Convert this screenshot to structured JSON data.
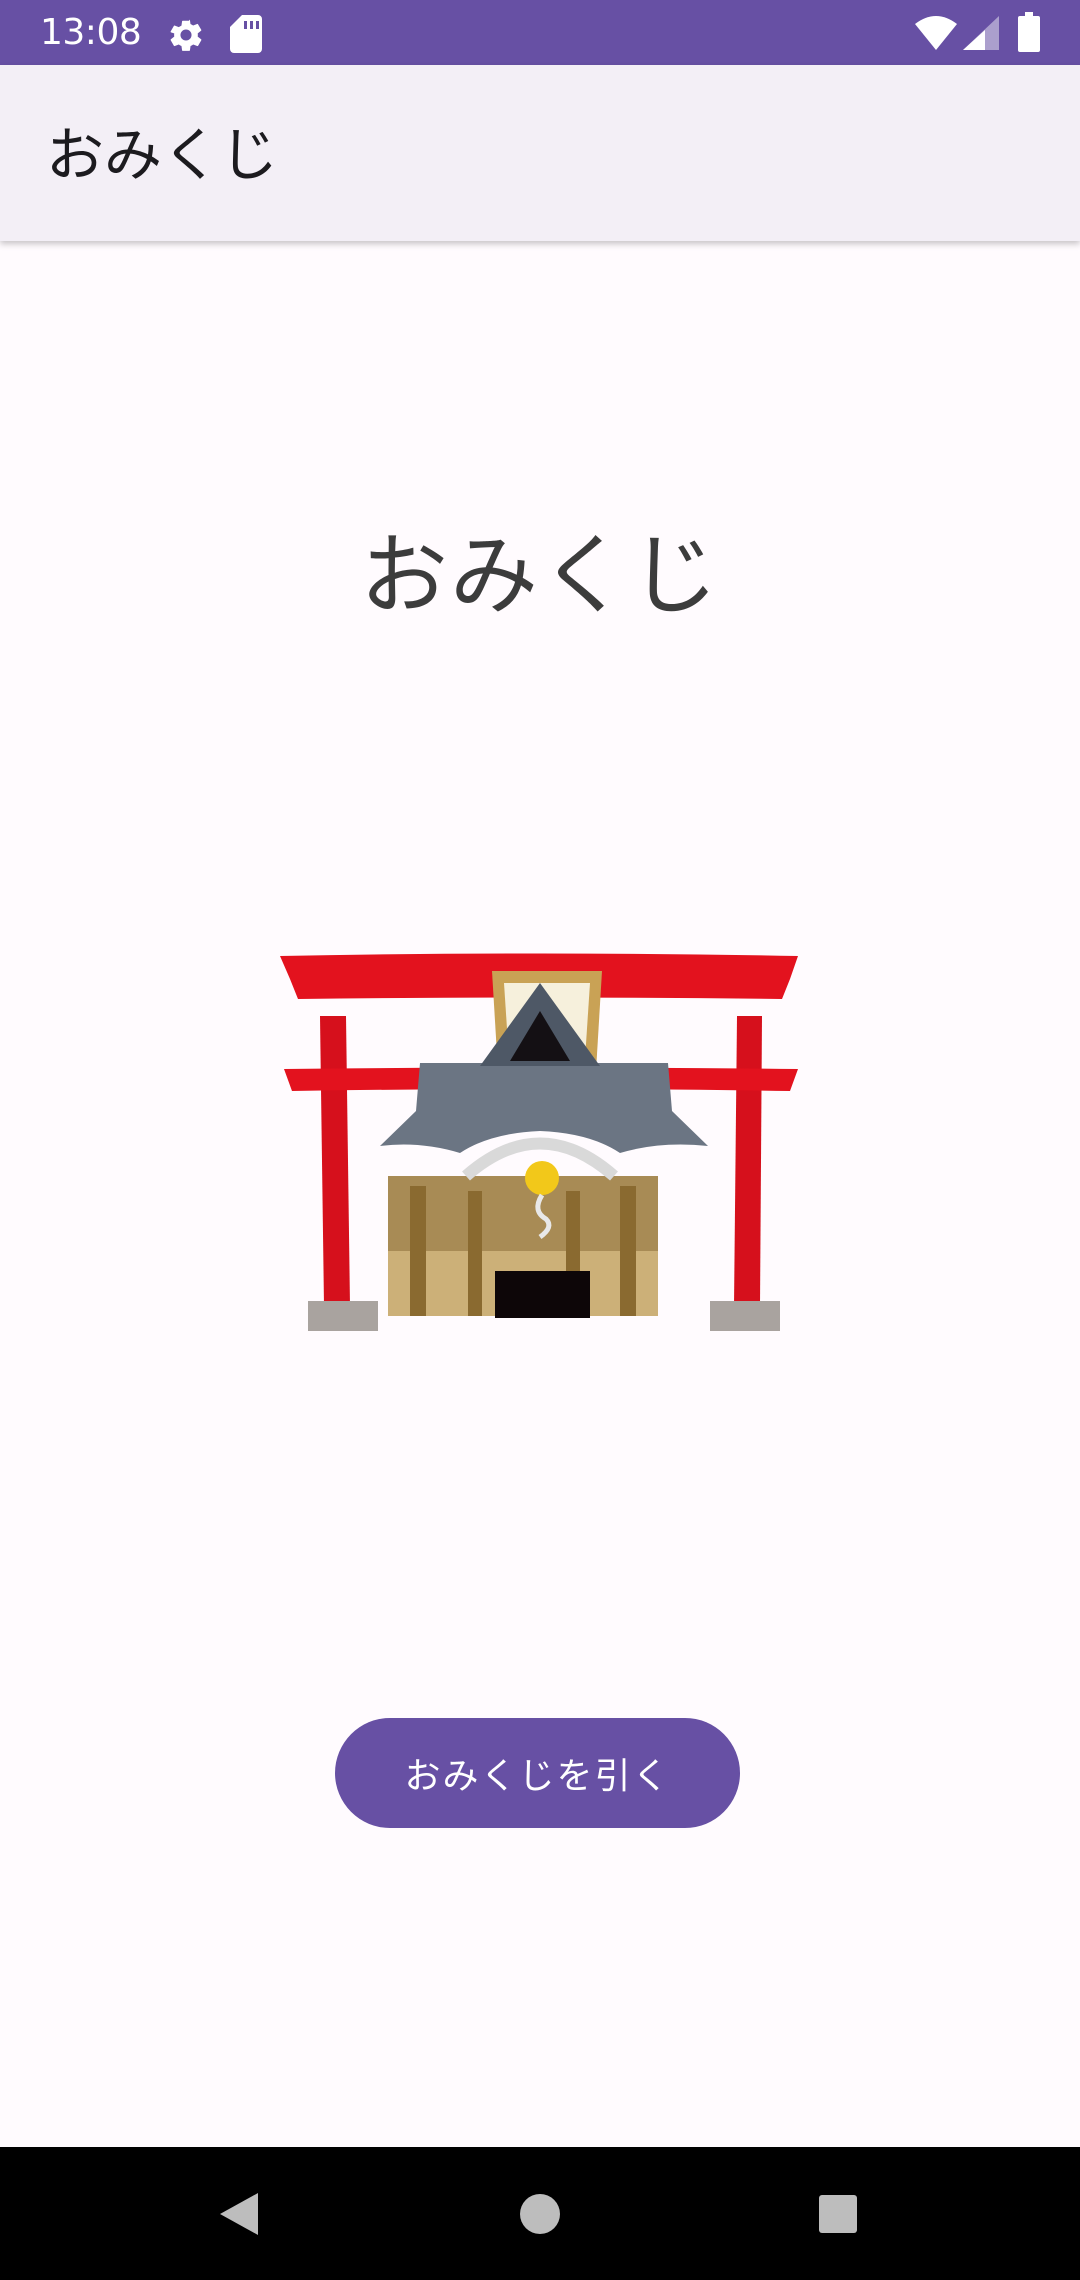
{
  "status_bar": {
    "time": "13:08",
    "icons": [
      "settings-icon",
      "sd-card-icon",
      "wifi-icon",
      "cell-signal-icon",
      "battery-icon"
    ]
  },
  "app_bar": {
    "title": "おみくじ"
  },
  "main": {
    "heading": "おみくじ",
    "image": "torii-shrine-illustration",
    "button_label": "おみくじを引く"
  },
  "nav_bar": {
    "buttons": [
      "back-icon",
      "home-icon",
      "recents-icon"
    ]
  },
  "colors": {
    "primary": "#6750a4",
    "app_bar_bg": "#f3eff6",
    "background": "#fffbfe",
    "torii_red": "#e0141f"
  }
}
